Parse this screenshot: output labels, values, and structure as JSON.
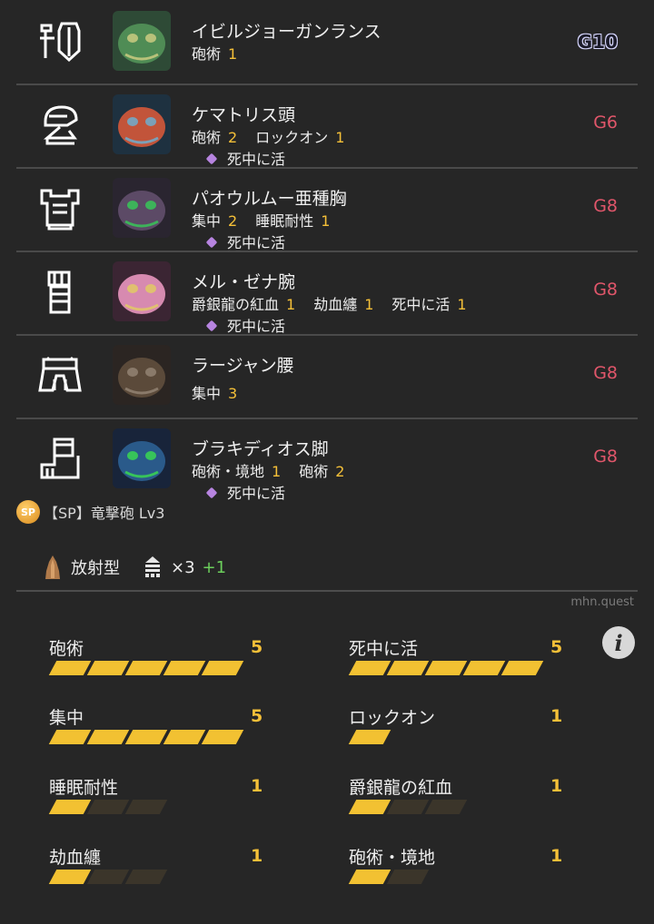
{
  "armor": [
    {
      "name": "イビルジョーガンランス",
      "grade": "G10",
      "slot": "weapon-slot-icon",
      "monster": "deviljho-portrait-icon",
      "skills": [
        {
          "name": "砲術",
          "level": "1"
        }
      ],
      "set_bonus": ""
    },
    {
      "name": "ケマトリス頭",
      "grade": "G6",
      "slot": "head-slot-icon",
      "monster": "tetranadon-portrait-icon",
      "skills": [
        {
          "name": "砲術",
          "level": "2"
        },
        {
          "name": "ロックオン",
          "level": "1"
        }
      ],
      "set_bonus": "死中に活"
    },
    {
      "name": "パオウルムー亜種胸",
      "grade": "G8",
      "slot": "chest-slot-icon",
      "monster": "pukei-portrait-icon",
      "skills": [
        {
          "name": "集中",
          "level": "2"
        },
        {
          "name": "睡眠耐性",
          "level": "1"
        }
      ],
      "set_bonus": "死中に活"
    },
    {
      "name": "メル・ゼナ腕",
      "grade": "G8",
      "slot": "arms-slot-icon",
      "monster": "malzeno-portrait-icon",
      "skills": [
        {
          "name": "爵銀龍の紅血",
          "level": "1"
        },
        {
          "name": "劫血纏",
          "level": "1"
        },
        {
          "name": "死中に活",
          "level": "1"
        }
      ],
      "set_bonus": "死中に活"
    },
    {
      "name": "ラージャン腰",
      "grade": "G8",
      "slot": "waist-slot-icon",
      "monster": "rajang-portrait-icon",
      "skills": [
        {
          "name": "集中",
          "level": "3"
        }
      ],
      "set_bonus": ""
    },
    {
      "name": "ブラキディオス脚",
      "grade": "G8",
      "slot": "legs-slot-icon",
      "monster": "brachydios-portrait-icon",
      "skills": [
        {
          "name": "砲術・境地",
          "level": "1"
        },
        {
          "name": "砲術",
          "level": "2"
        }
      ],
      "set_bonus": "死中に活"
    }
  ],
  "special_skill": {
    "badge": "SP",
    "label": "【SP】竜撃砲 Lv3"
  },
  "weapon": {
    "shell_type": "放射型",
    "shell_count": "×3",
    "shell_bonus": "+1"
  },
  "site": "mhn.quest",
  "summary": [
    {
      "name": "砲術",
      "level": 5,
      "max": 5
    },
    {
      "name": "死中に活",
      "level": 5,
      "max": 5
    },
    {
      "name": "集中",
      "level": 5,
      "max": 5
    },
    {
      "name": "ロックオン",
      "level": 1,
      "max": 1
    },
    {
      "name": "睡眠耐性",
      "level": 1,
      "max": 3
    },
    {
      "name": "爵銀龍の紅血",
      "level": 1,
      "max": 3
    },
    {
      "name": "劫血纏",
      "level": 1,
      "max": 3
    },
    {
      "name": "砲術・境地",
      "level": 1,
      "max": 2
    }
  ],
  "colors": {
    "background": "#262626",
    "level": "#f5c038",
    "grade": "#e0566a",
    "set_bonus_dot": "#b784e0",
    "bar_on": "#f2c132",
    "bar_off": "#3b352a",
    "shell_bonus": "#6ccf5c"
  }
}
